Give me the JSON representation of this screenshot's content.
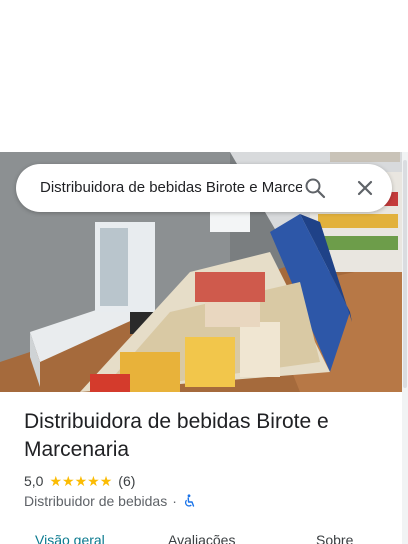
{
  "search": {
    "query": "Distribuidora de bebidas Birote e Marcenaria"
  },
  "place": {
    "name": "Distribuidora de bebidas Birote e Marcenaria",
    "rating": "5,0",
    "stars": 5,
    "review_count": "(6)",
    "category": "Distribuidor de bebidas",
    "separator": "·"
  },
  "tabs": [
    {
      "label": "Visão geral",
      "active": true
    },
    {
      "label": "Avaliações",
      "active": false
    },
    {
      "label": "Sobre",
      "active": false
    }
  ],
  "icons": {
    "search": "search-icon",
    "close": "close-icon",
    "wheelchair": "wheelchair-accessible-icon"
  },
  "colors": {
    "star": "#fbbc04",
    "accessibility_icon": "#1a73e8",
    "active_tab": "#0b7a8f"
  }
}
